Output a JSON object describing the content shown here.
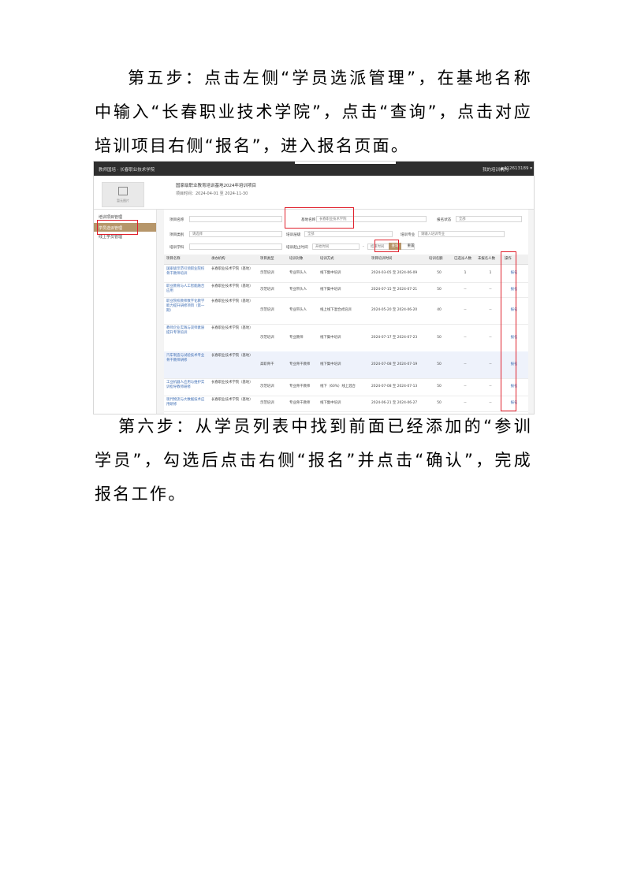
{
  "paragraphs": {
    "step5": "第五步：点击左侧“学员选派管理”，在基地名称中输入“长春职业技术学院”，点击“查询”，点击对应培训项目右侧“报名”，进入报名页面。",
    "step6": "第六步：从学员列表中找到前面已经添加的“参训学员”，勾选后点击右侧“报名”并点击“确认”，完成报名工作。"
  },
  "screenshot": {
    "topbar": {
      "title": "教师国培 · 长春职业技术学院",
      "right_link": "我的培训机构",
      "user": "▲412613189 ▾"
    },
    "info": {
      "logo_text": "暂无图片",
      "line1": "国家级职业教育培训基地2024年培训项目",
      "line2": "项目时间：2024-04-01 至 2024-11-30"
    },
    "sidebar": [
      "培训项目管理",
      "学员选派管理",
      "线上学员管理"
    ],
    "filters": {
      "project_name_label": "项目名称",
      "base_name_label": "基地名称",
      "base_name_value": "长春职业技术学院",
      "status_label": "报名状态",
      "status_value": "全部",
      "category_label": "项目类别",
      "category_value": "请选择",
      "level_label": "培训层级",
      "level_value": "全部",
      "direction_label": "培训专业",
      "direction_placeholder": "请输入培训专业",
      "subject_label": "培训学科",
      "date_label": "培训起止时间",
      "start_placeholder": "开始时间",
      "sep": "-",
      "end_placeholder": "结束时间",
      "query_btn": "查询",
      "reset_btn": "重置"
    },
    "columns": [
      "项目名称",
      "承办机构",
      "项目类型",
      "培训对象",
      "培训方式",
      "项目培训时间",
      "培训名额",
      "已选派人数",
      "未报名人数",
      "操作"
    ],
    "rows": [
      {
        "name": "国家级示范引领职业院校骨干教师培训",
        "org": "长春职业技术学院（基地）",
        "type": "示范培训",
        "target": "专业带头人",
        "mode": "线下集中培训",
        "time": "2024-03-05 至 2024-06-09",
        "quota": "50",
        "sel": "1",
        "un": "1",
        "op": "报名"
      },
      {
        "name": "职业教育与人工智能融合应用",
        "org": "长春职业技术学院（基地）",
        "type": "示范培训",
        "target": "专业带头人",
        "mode": "线下集中培训",
        "time": "2024-07-15 至 2024-07-21",
        "quota": "50",
        "sel": "--",
        "un": "--",
        "op": "报名"
      },
      {
        "name": "职业院校教师数字化教学能力提升研修项目（第一期）",
        "org": "长春职业技术学院（基地）",
        "type": "示范培训",
        "target": "专业带头人",
        "mode": "线上线下混合式培训",
        "time": "2024-05-20 至 2024-06-20",
        "quota": "40",
        "sel": "--",
        "un": "--",
        "op": "报名"
      },
      {
        "name": "教师企业实践与双师素质提升专项培训",
        "org": "长春职业技术学院（基地）",
        "type": "示范培训",
        "target": "专业教师",
        "mode": "线下集中培训",
        "time": "2024-07-17 至 2024-07-23",
        "quota": "50",
        "sel": "--",
        "un": "--",
        "op": "报名"
      },
      {
        "name": "汽车制造与试验技术专业骨干教师研修",
        "org": "长春职业技术学院（基地）",
        "type": "高职骨干",
        "target": "专业骨干教师",
        "mode": "线下集中培训",
        "time": "2024-07-08 至 2024-07-19",
        "quota": "50",
        "sel": "--",
        "un": "--",
        "op": "报名"
      },
      {
        "name": "工业机器人应用与维护实训指导教师研修",
        "org": "长春职业技术学院（基地）",
        "type": "示范培训",
        "target": "专业骨干教师",
        "mode": "线下（60%）线上混合",
        "time": "2024-07-08 至 2024-07-13",
        "quota": "50",
        "sel": "--",
        "un": "--",
        "op": "报名"
      },
      {
        "name": "现代物流与大数据技术应用研修",
        "org": "长春职业技术学院（基地）",
        "type": "示范培训",
        "target": "专业骨干教师",
        "mode": "线下集中培训",
        "time": "2024-06-21 至 2024-06-27",
        "quota": "50",
        "sel": "--",
        "un": "--",
        "op": "报名"
      }
    ]
  }
}
